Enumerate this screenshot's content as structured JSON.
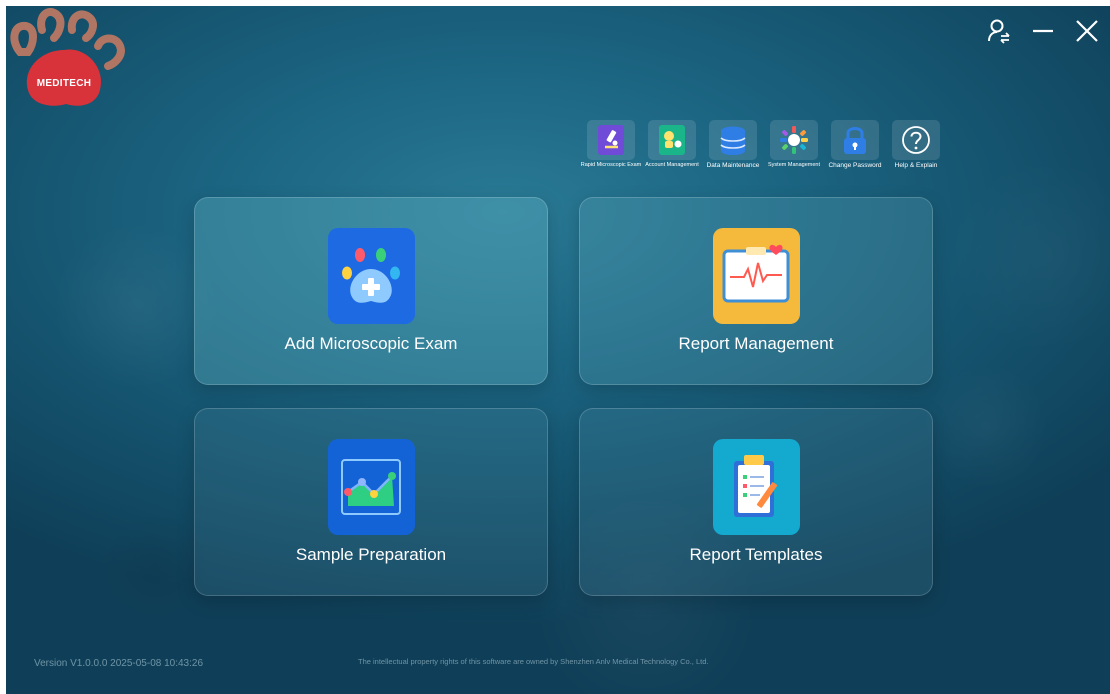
{
  "brand": {
    "logo_text": "MEDITECH",
    "logo_color": "#d8323a",
    "paw_color": "#b07563"
  },
  "window_controls": {
    "user_switch": "user-switch-icon",
    "minimize": "minimize-icon",
    "close": "close-icon"
  },
  "toolbar": [
    {
      "label": "Rapid Microscopic Exam",
      "icon": "microscope-icon"
    },
    {
      "label": "Account Management",
      "icon": "account-icon"
    },
    {
      "label": "Data Maintenance",
      "icon": "database-icon"
    },
    {
      "label": "System Management",
      "icon": "system-gear-icon"
    },
    {
      "label": "Change Password",
      "icon": "lock-icon"
    },
    {
      "label": "Help & Explain",
      "icon": "help-icon"
    }
  ],
  "cards": [
    {
      "label": "Add Microscopic Exam",
      "icon": "paw-plus-icon",
      "icon_color": "#1e6ae3"
    },
    {
      "label": "Report Management",
      "icon": "heartbeat-report-icon",
      "icon_color": "#f5b93c"
    },
    {
      "label": "Sample Preparation",
      "icon": "line-chart-icon",
      "icon_color": "#1463d6"
    },
    {
      "label": "Report Templates",
      "icon": "clipboard-icon",
      "icon_color": "#14a9cf"
    }
  ],
  "footer": {
    "version": "Version V1.0.0.0 2025-05-08 10:43:26",
    "copyright": "The intellectual property rights of this software are owned by Shenzhen Anlv Medical Technology Co., Ltd."
  }
}
